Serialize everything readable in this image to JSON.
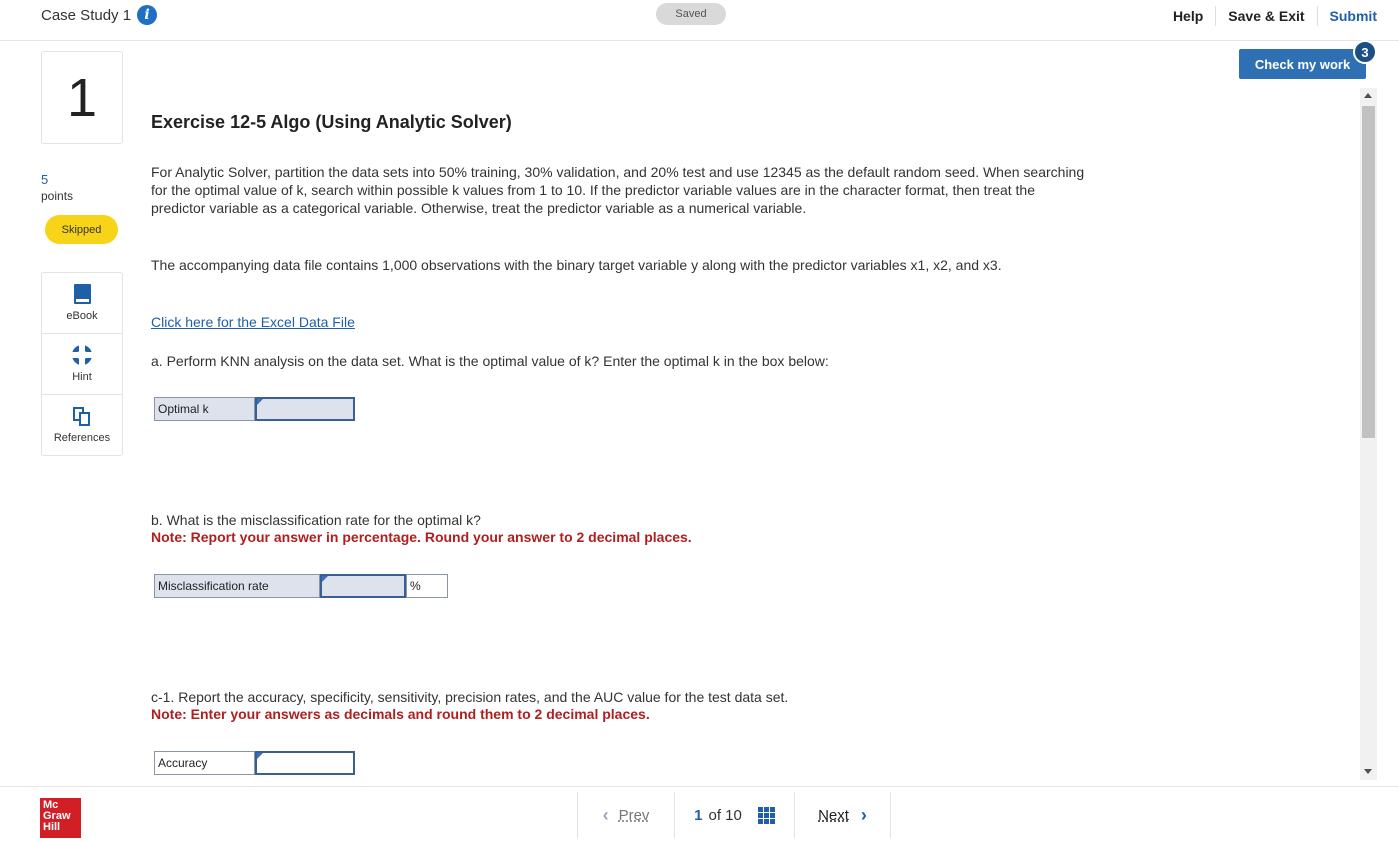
{
  "header": {
    "case_title": "Case Study 1",
    "saved": "Saved",
    "help": "Help",
    "save_exit": "Save & Exit",
    "submit": "Submit"
  },
  "check": {
    "label": "Check my work",
    "badge": "3"
  },
  "left": {
    "question_number": "1",
    "points_value": "5",
    "points_label": "points",
    "status": "Skipped",
    "tools": [
      {
        "label": "eBook",
        "icon": "book-icon"
      },
      {
        "label": "Hint",
        "icon": "lifebuoy-icon"
      },
      {
        "label": "References",
        "icon": "copy-icon"
      }
    ]
  },
  "question": {
    "title": "Exercise 12-5 Algo (Using Analytic Solver)",
    "intro": "For Analytic Solver, partition the data sets into 50% training, 30% validation, and 20% test and use 12345 as the default random seed. When searching for the optimal value of k, search within possible k values from 1 to 10. If the predictor variable values are in the character format, then treat the predictor variable as a categorical variable. Otherwise, treat the predictor variable as a numerical variable.",
    "data_desc": "The accompanying data file contains 1,000 observations with the binary target variable y along with the predictor variables x1, x2, and x3.",
    "link": "Click here for the Excel Data File",
    "part_a": "a. Perform KNN analysis on the data set. What is the optimal value of k? Enter the optimal k in the box below:",
    "part_a_label": "Optimal k",
    "part_a_value": "",
    "part_b": "b. What is the misclassification rate for the optimal k?",
    "part_b_note": "Note: Report your answer in percentage. Round your answer to 2 decimal places.",
    "part_b_label": "Misclassification rate",
    "part_b_value": "",
    "part_b_unit": "%",
    "part_c1": "c-1. Report the accuracy, specificity, sensitivity, precision rates, and the AUC value for the test data set.",
    "part_c1_note": "Note: Enter your answers as decimals and round them to 2 decimal places.",
    "part_c1_label": "Accuracy",
    "part_c1_value": ""
  },
  "footer": {
    "logo_line1": "Mc",
    "logo_line2": "Graw",
    "logo_line3": "Hill",
    "prev": "Prev",
    "current": "1",
    "of_label": "of 10",
    "next": "Next"
  },
  "colors": {
    "accent": "#1f5fa8",
    "check_button": "#2f6fb4",
    "skipped_badge": "#f7d417",
    "note_red": "#b01f1f",
    "logo_red": "#d21f26"
  }
}
